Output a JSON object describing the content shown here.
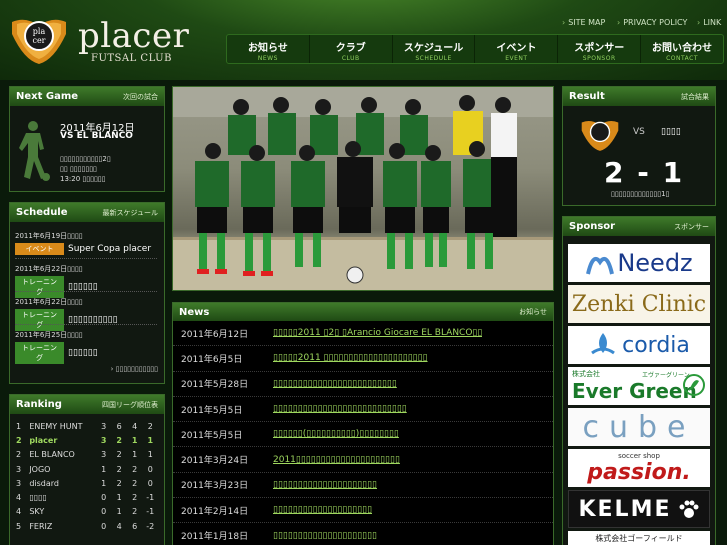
{
  "header": {
    "logo_text": "placer",
    "logo_sub": "FUTSAL CLUB",
    "emblem_text": "pla cer",
    "util_links": [
      "SITE MAP",
      "PRIVACY POLICY",
      "LINK"
    ]
  },
  "nav": [
    {
      "label": "お知らせ",
      "sub": "NEWS"
    },
    {
      "label": "クラブ",
      "sub": "CLUB"
    },
    {
      "label": "スケジュール",
      "sub": "SCHEDULE"
    },
    {
      "label": "イベント",
      "sub": "EVENT"
    },
    {
      "label": "スポンサー",
      "sub": "SPONSOR"
    },
    {
      "label": "お問い合わせ",
      "sub": "CONTACT"
    }
  ],
  "next_game": {
    "title": "Next Game",
    "sub": "次回の試合",
    "date": "2011年6月12日",
    "opponent": "VS EL BLANCO",
    "venue_line1": "▯▯▯▯▯▯▯▯▯▯▯2▯",
    "venue_line2": "▯▯ ▯▯▯▯▯▯▯",
    "time": "13:20 ▯▯▯▯▯▯"
  },
  "schedule": {
    "title": "Schedule",
    "sub": "最新スケジュール",
    "items": [
      {
        "date": "2011年6月19日▯▯▯▯",
        "type": "イベント",
        "kind": "event",
        "text": "Super Copa placer"
      },
      {
        "date": "2011年6月22日▯▯▯▯",
        "type": "トレーニング",
        "kind": "training",
        "text": "▯▯▯▯▯▯"
      },
      {
        "date": "2011年6月22日▯▯▯▯",
        "type": "トレーニング",
        "kind": "training",
        "text": "▯▯▯▯▯▯▯▯▯▯"
      },
      {
        "date": "2011年6月25日▯▯▯▯",
        "type": "トレーニング",
        "kind": "training",
        "text": "▯▯▯▯▯▯"
      }
    ],
    "more": "▯▯▯▯▯▯▯▯▯▯▯"
  },
  "ranking": {
    "title": "Ranking",
    "sub": "四国リーグ順位表",
    "rows": [
      {
        "pos": "1",
        "team": "ENEMY HUNT",
        "a": "3",
        "b": "6",
        "c": "4",
        "d": "2"
      },
      {
        "pos": "2",
        "team": "placer",
        "a": "3",
        "b": "2",
        "c": "1",
        "d": "1",
        "highlight": true
      },
      {
        "pos": "2",
        "team": "EL BLANCO",
        "a": "3",
        "b": "2",
        "c": "1",
        "d": "1"
      },
      {
        "pos": "3",
        "team": "JOGO",
        "a": "1",
        "b": "2",
        "c": "2",
        "d": "0"
      },
      {
        "pos": "3",
        "team": "disdard",
        "a": "1",
        "b": "2",
        "c": "2",
        "d": "0"
      },
      {
        "pos": "4",
        "team": "▯▯▯▯",
        "a": "0",
        "b": "1",
        "c": "2",
        "d": "-1"
      },
      {
        "pos": "4",
        "team": "SKY",
        "a": "0",
        "b": "1",
        "c": "2",
        "d": "-1"
      },
      {
        "pos": "5",
        "team": "FERIZ",
        "a": "0",
        "b": "4",
        "c": "6",
        "d": "-2"
      }
    ]
  },
  "news": {
    "title": "News",
    "sub": "お知らせ",
    "items": [
      {
        "date": "2011年6月12日",
        "title": "▯▯▯▯▯2011 ▯2▯ ▯Arancio Giocare EL BLANCO▯▯"
      },
      {
        "date": "2011年6月5日",
        "title": "▯▯▯▯▯2011 ▯▯▯▯▯▯▯▯▯▯▯▯▯▯▯▯▯▯▯▯▯"
      },
      {
        "date": "2011年5月28日",
        "title": "▯▯▯▯▯▯▯▯▯▯▯▯▯▯▯▯▯▯▯▯▯▯▯▯▯"
      },
      {
        "date": "2011年5月5日",
        "title": "▯▯▯▯▯▯▯▯▯▯▯▯▯▯▯▯▯▯▯▯▯▯▯▯▯▯▯"
      },
      {
        "date": "2011年5月5日",
        "title": "▯▯▯▯▯▯(▯▯▯▯▯▯▯▯▯▯)▯▯▯▯▯▯▯▯"
      },
      {
        "date": "2011年3月24日",
        "title": "2011▯▯▯▯▯▯▯▯▯▯▯▯▯▯▯▯▯▯▯▯▯"
      },
      {
        "date": "2011年3月23日",
        "title": "▯▯▯▯▯▯▯▯▯▯▯▯▯▯▯▯▯▯▯▯▯"
      },
      {
        "date": "2011年2月14日",
        "title": "▯▯▯▯▯▯▯▯▯▯▯▯▯▯▯▯▯▯▯▯"
      },
      {
        "date": "2011年1月18日",
        "title": "▯▯▯▯▯▯▯▯▯▯▯▯▯▯▯▯▯▯▯▯▯"
      }
    ]
  },
  "result": {
    "title": "Result",
    "sub": "試合結果",
    "vs": "VS",
    "opponent": "▯▯▯▯",
    "score": "2 - 1",
    "note": "▯▯▯▯▯▯▯▯▯▯▯▯▯1▯"
  },
  "sponsor": {
    "title": "Sponsor",
    "sub": "スポンサー",
    "items": [
      {
        "name": "Needz",
        "color": "#1a3a8a"
      },
      {
        "name": "Zenki Clinic",
        "color": "#8a6a1a"
      },
      {
        "name": "cordia",
        "color": "#1a5aaa"
      },
      {
        "name": "Ever Green",
        "prefix": "株式会社",
        "right": "エヴァーグリーン",
        "color": "#1a7a2a"
      },
      {
        "name": "cube",
        "color": "#7aa0c0"
      },
      {
        "name": "passion.",
        "prefix": "soccer shop",
        "color": "#c01a1a"
      },
      {
        "name": "KELME",
        "color": "#ffffff"
      },
      {
        "name": "株式会社ゴーフィールド",
        "color": "#222222"
      }
    ]
  }
}
